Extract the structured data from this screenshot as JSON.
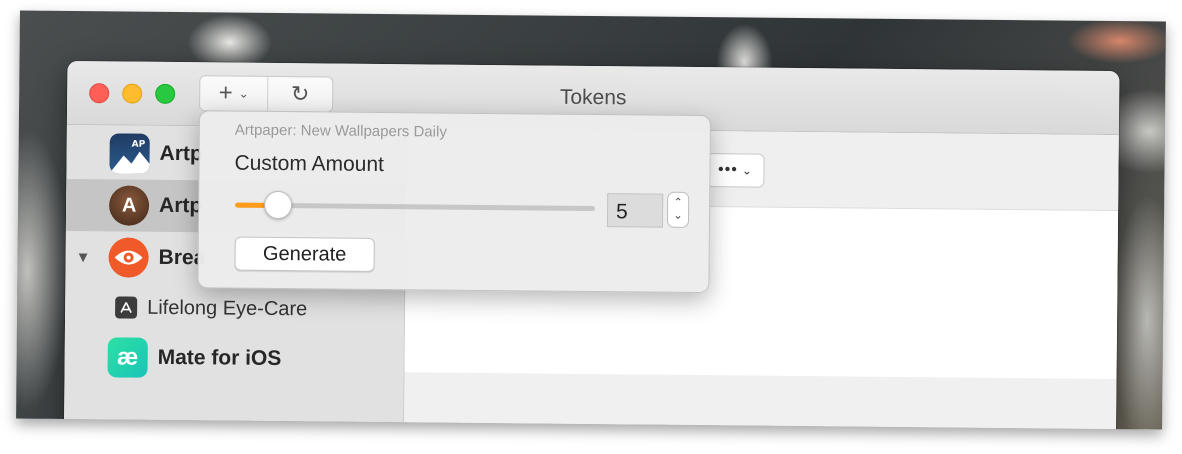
{
  "window": {
    "title": "Tokens"
  },
  "toolbar": {
    "add_symbol": "+",
    "chevron_symbol": "⌄",
    "refresh_symbol": "↻"
  },
  "sidebar": {
    "items": [
      {
        "label": "Artpaper: New Wallpapers Daily",
        "visible_label": "Artp",
        "icon": "artpaper-app-icon",
        "bold": true,
        "selected": false
      },
      {
        "label": "Artpaper",
        "visible_label": "Artp",
        "icon_text": "A",
        "icon": "artpaper-a-app-icon",
        "bold": true,
        "selected": true
      },
      {
        "label": "Break",
        "visible_label": "Brea",
        "icon": "eye-app-icon",
        "bold": true,
        "selected": false,
        "expanded": true
      },
      {
        "label": "Lifelong Eye-Care",
        "visible_label": "Lifelong Eye-Care",
        "icon": "app-store-icon",
        "bold": false,
        "selected": false
      },
      {
        "label": "Mate for iOS",
        "visible_label": "Mate for iOS",
        "icon_text": "æ",
        "icon": "mate-app-icon",
        "bold": true,
        "selected": false
      }
    ]
  },
  "main": {
    "more_button_label": "•••"
  },
  "popover": {
    "subtitle": "Artpaper: New Wallpapers Daily",
    "title": "Custom Amount",
    "amount_value": "5",
    "slider_fraction": 0.08,
    "generate_label": "Generate",
    "stepper_up": "⌃",
    "stepper_down": "⌄"
  },
  "colors": {
    "close": "#ff5f57",
    "minimize": "#febc2e",
    "maximize": "#28c840",
    "slider_accent": "#ff9b1a",
    "selected_row": "#c5c5c5"
  }
}
